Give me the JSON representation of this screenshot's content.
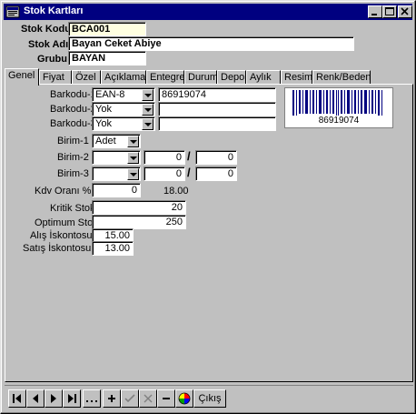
{
  "window": {
    "title": "Stok Kartları"
  },
  "header": {
    "stok_kodu_label": "Stok Kodu",
    "stok_kodu_value": "BCA001",
    "stok_adi_label": "Stok Adı",
    "stok_adi_value": "Bayan Ceket Abiye",
    "grubu_label": "Grubu",
    "grubu_value": "BAYAN"
  },
  "tabs": [
    {
      "label": "Genel",
      "active": true
    },
    {
      "label": "Fiyat"
    },
    {
      "label": "Özel"
    },
    {
      "label": "Açıklama"
    },
    {
      "label": "Entegre"
    },
    {
      "label": "Durum"
    },
    {
      "label": "Depo"
    },
    {
      "label": "Aylık"
    },
    {
      "label": "Resim"
    },
    {
      "label": "Renk/Beden"
    }
  ],
  "genel": {
    "barkodu1_label": "Barkodu-1",
    "barkodu1_type": "EAN-8",
    "barkodu1_value": "86919074",
    "barkodu2_label": "Barkodu-2",
    "barkodu2_type": "Yok",
    "barkodu2_value": "",
    "barkodu3_label": "Barkodu-3",
    "barkodu3_type": "Yok",
    "barkodu3_value": "",
    "barcode_text": "86919074",
    "birim1_label": "Birim-1",
    "birim1_value": "Adet",
    "birim2_label": "Birim-2",
    "birim2_value": "",
    "birim2_num1": "0",
    "birim2_num2": "0",
    "birim3_label": "Birim-3",
    "birim3_value": "",
    "birim3_num1": "0",
    "birim3_num2": "0",
    "kdv_label": "Kdv Oranı %",
    "kdv_value": "0",
    "kdv_display": "18.00",
    "kritik_stok_label": "Kritik Stok",
    "kritik_stok_value": "20",
    "optimum_stok_label": "Optimum Stok",
    "optimum_stok_value": "250",
    "alis_iskonto_label": "Alış İskontosu %",
    "alis_iskonto_value": "15.00",
    "satis_iskonto_label": "Satış İskontosu %",
    "satis_iskonto_value": "13.00"
  },
  "navbar": {
    "first": "first-record",
    "prev": "previous-record",
    "next": "next-record",
    "last": "last-record",
    "cikis_label": "Çıkış"
  }
}
